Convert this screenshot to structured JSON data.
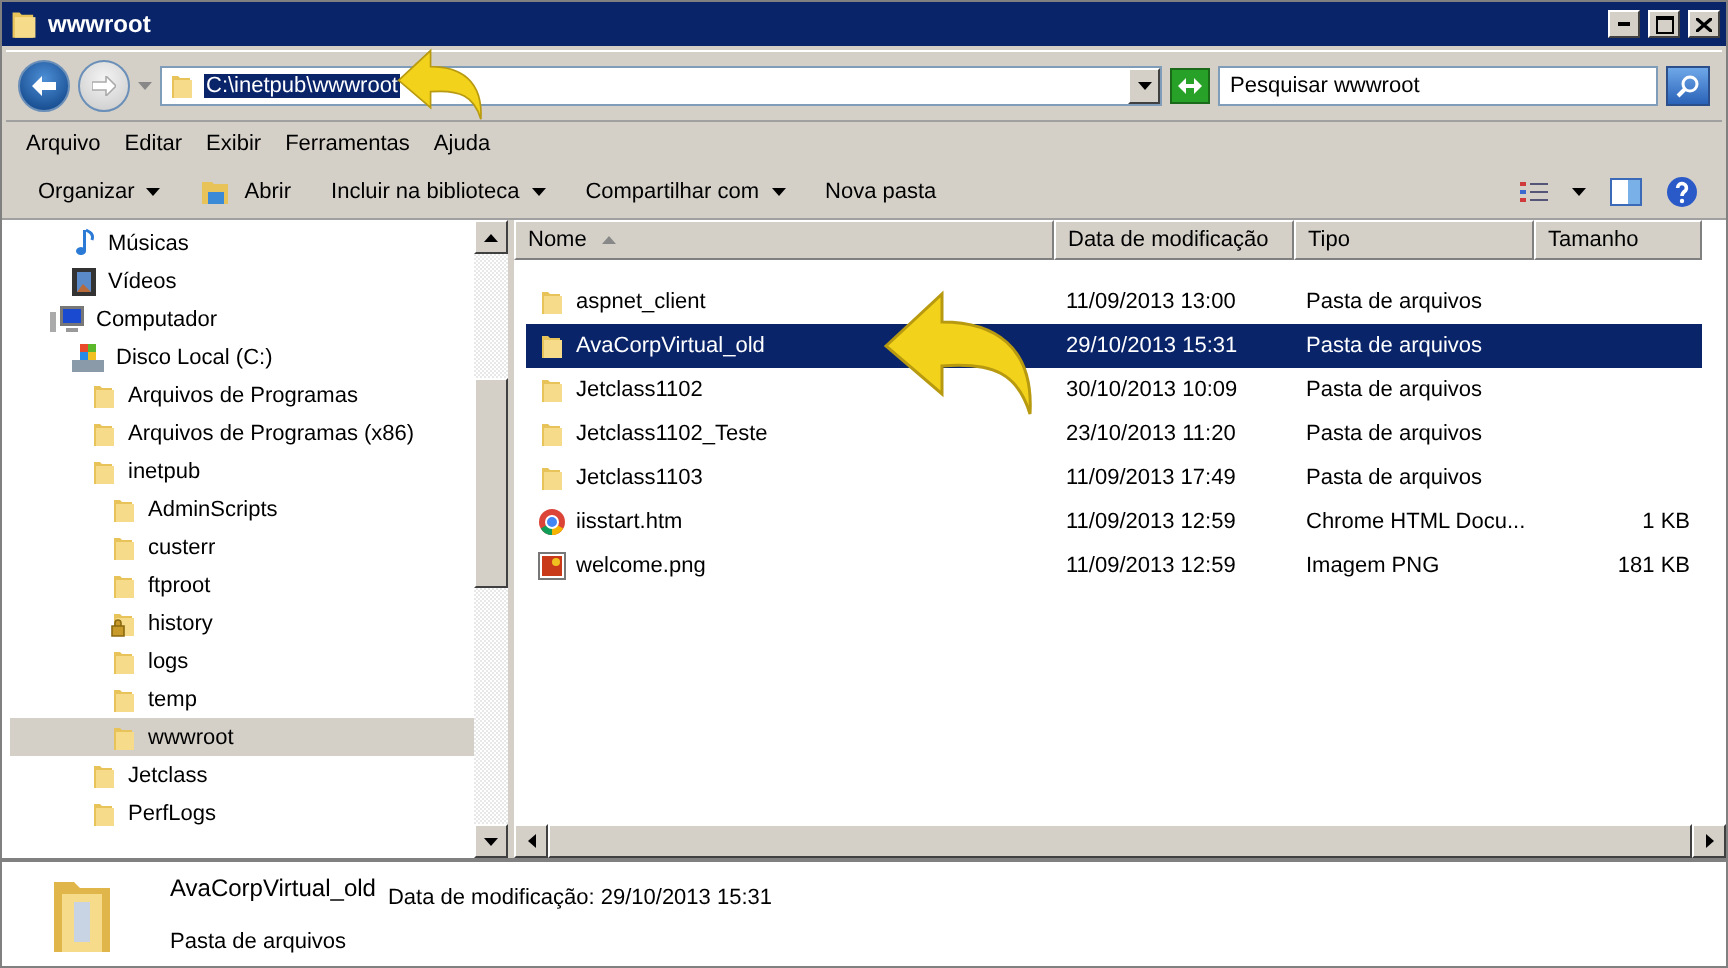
{
  "window": {
    "title": "wwwroot"
  },
  "address": {
    "path": "C:\\inetpub\\wwwroot",
    "selected": true
  },
  "search": {
    "placeholder": "Pesquisar wwwroot"
  },
  "menu": [
    "Arquivo",
    "Editar",
    "Exibir",
    "Ferramentas",
    "Ajuda"
  ],
  "toolbar": [
    {
      "label": "Organizar",
      "dropdown": true,
      "icon": false
    },
    {
      "label": "Abrir",
      "dropdown": false,
      "icon": true
    },
    {
      "label": "Incluir na biblioteca",
      "dropdown": true,
      "icon": false
    },
    {
      "label": "Compartilhar com",
      "dropdown": true,
      "icon": false
    },
    {
      "label": "Nova pasta",
      "dropdown": false,
      "icon": false
    }
  ],
  "tree": [
    {
      "label": "Músicas",
      "kind": "music",
      "selected": false
    },
    {
      "label": "Vídeos",
      "kind": "video",
      "selected": false
    },
    {
      "label": "Computador",
      "kind": "computer",
      "selected": false,
      "children": [
        {
          "label": "Disco Local (C:)",
          "kind": "drive",
          "selected": false,
          "children": [
            {
              "label": "Arquivos de Programas",
              "kind": "folder",
              "selected": false
            },
            {
              "label": "Arquivos de Programas (x86)",
              "kind": "folder",
              "selected": false
            },
            {
              "label": "inetpub",
              "kind": "folder",
              "selected": false,
              "children": [
                {
                  "label": "AdminScripts",
                  "kind": "folder",
                  "selected": false
                },
                {
                  "label": "custerr",
                  "kind": "folder",
                  "selected": false
                },
                {
                  "label": "ftproot",
                  "kind": "folder",
                  "selected": false
                },
                {
                  "label": "history",
                  "kind": "locked",
                  "selected": false
                },
                {
                  "label": "logs",
                  "kind": "folder",
                  "selected": false
                },
                {
                  "label": "temp",
                  "kind": "folder",
                  "selected": false
                },
                {
                  "label": "wwwroot",
                  "kind": "folder",
                  "selected": true
                }
              ]
            },
            {
              "label": "Jetclass",
              "kind": "folder",
              "selected": false
            },
            {
              "label": "PerfLogs",
              "kind": "folder",
              "selected": false
            }
          ]
        }
      ]
    }
  ],
  "table": {
    "columns": [
      "Nome",
      "Data de modificação",
      "Tipo",
      "Tamanho"
    ],
    "rows": [
      {
        "kind": "folder",
        "name": "aspnet_client",
        "date": "11/09/2013 13:00",
        "type": "Pasta de arquivos",
        "selected": false
      },
      {
        "kind": "folder",
        "name": "AvaCorpVirtual_old",
        "date": "29/10/2013 15:31",
        "type": "Pasta de arquivos",
        "selected": true
      },
      {
        "kind": "folder",
        "name": "Jetclass1102",
        "date": "30/10/2013 10:09",
        "type": "Pasta de arquivos",
        "selected": false
      },
      {
        "kind": "folder",
        "name": "Jetclass1102_Teste",
        "date": "23/10/2013 11:20",
        "type": "Pasta de arquivos",
        "selected": false
      },
      {
        "kind": "folder",
        "name": "Jetclass1103",
        "date": "11/09/2013 17:49",
        "type": "Pasta de arquivos",
        "selected": false
      },
      {
        "kind": "web",
        "name": "iisstart.htm",
        "date": "11/09/2013 12:59",
        "type": "Chrome HTML Docu...",
        "size": "1 KB",
        "selected": false
      },
      {
        "kind": "image",
        "name": "welcome.png",
        "date": "11/09/2013 12:59",
        "type": "Imagem PNG",
        "size": "181 KB",
        "selected": false
      }
    ]
  },
  "details": {
    "name": "AvaCorpVirtual_old",
    "modified": "Data de modificação: 29/10/2013 15:31",
    "type": "Pasta de arquivos"
  }
}
